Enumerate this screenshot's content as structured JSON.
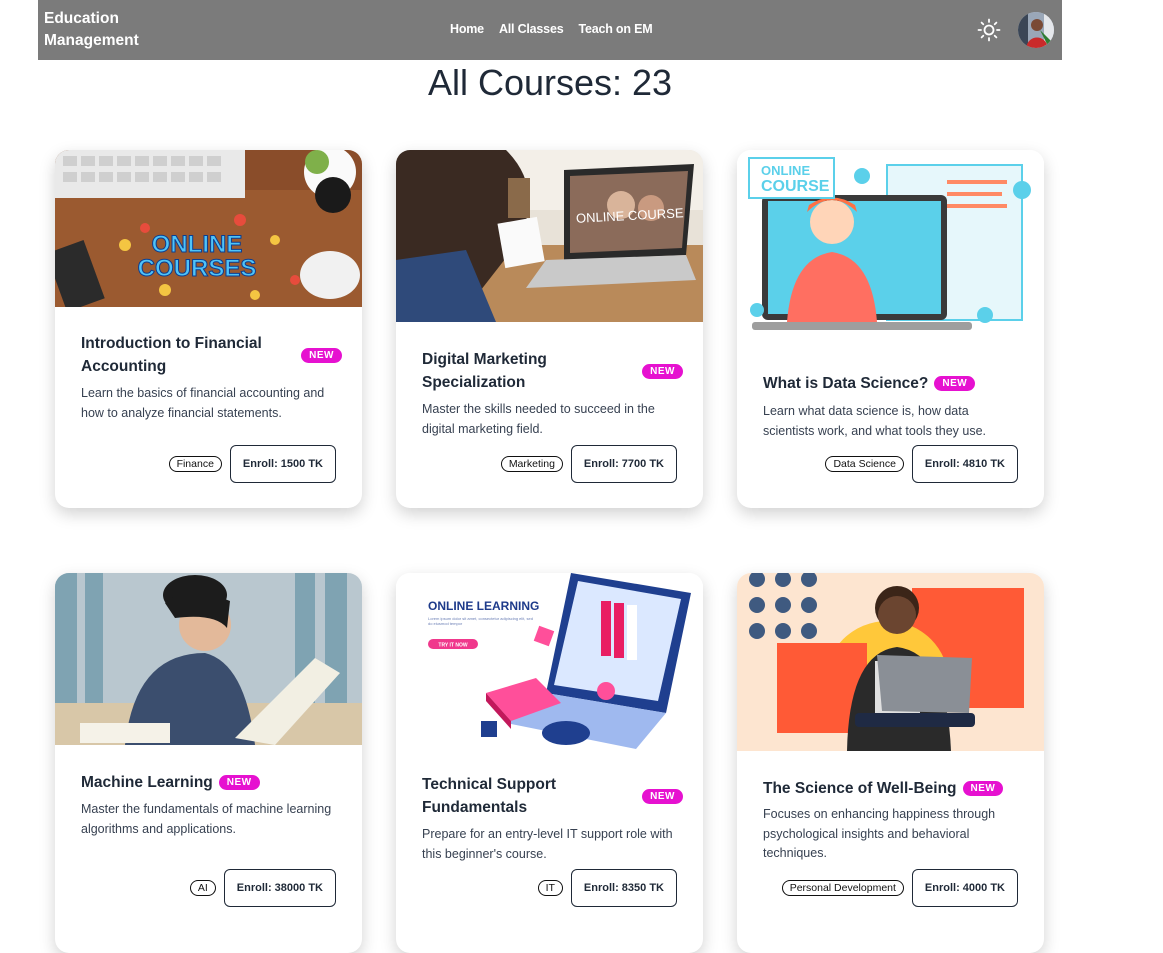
{
  "navbar": {
    "brand_line1": "Education",
    "brand_line2": "Management",
    "links": [
      "Home",
      "All Classes",
      "Teach on EM"
    ],
    "theme_icon": "sun-icon",
    "bg_color": "#7b7b7b"
  },
  "page": {
    "title": "All Courses: 23"
  },
  "colors": {
    "badge": "#e611d0"
  },
  "courses": [
    {
      "title": "Introduction to Financial Accounting",
      "badge": "NEW",
      "description": "Learn the basics of financial accounting and how to analyze financial statements.",
      "tag": "Finance",
      "enroll": "Enroll: 1500 TK",
      "image_text_1": "ONLINE",
      "image_text_2": "COURSES"
    },
    {
      "title": "Digital Marketing Specialization",
      "badge": "NEW",
      "description": "Master the skills needed to succeed in the digital marketing field.",
      "tag": "Marketing",
      "enroll": "Enroll: 7700 TK",
      "image_text_1": "ONLINE COURSE"
    },
    {
      "title": "What is Data Science?",
      "badge": "NEW",
      "description": "Learn what data science is, how data scientists work, and what tools they use.",
      "tag": "Data Science",
      "enroll": "Enroll: 4810 TK",
      "image_text_1": "ONLINE",
      "image_text_2": "COURSE"
    },
    {
      "title": "Machine Learning",
      "badge": "NEW",
      "description": "Master the fundamentals of machine learning algorithms and applications.",
      "tag": "AI",
      "enroll": "Enroll: 38000 TK"
    },
    {
      "title": "Technical Support Fundamentals",
      "badge": "NEW",
      "description": "Prepare for an entry-level IT support role with this beginner's course.",
      "tag": "IT",
      "enroll": "Enroll: 8350 TK",
      "image_text_1": "ONLINE LEARNING",
      "image_text_2": "Lorem ipsum dolor sit amet, consectetur adipiscing elit, sed do eiusmod tempor",
      "image_text_3": "TRY IT NOW"
    },
    {
      "title": "The Science of Well-Being",
      "badge": "NEW",
      "description": "Focuses on enhancing happiness through psychological insights and behavioral techniques.",
      "tag": "Personal Development",
      "enroll": "Enroll: 4000 TK"
    }
  ]
}
